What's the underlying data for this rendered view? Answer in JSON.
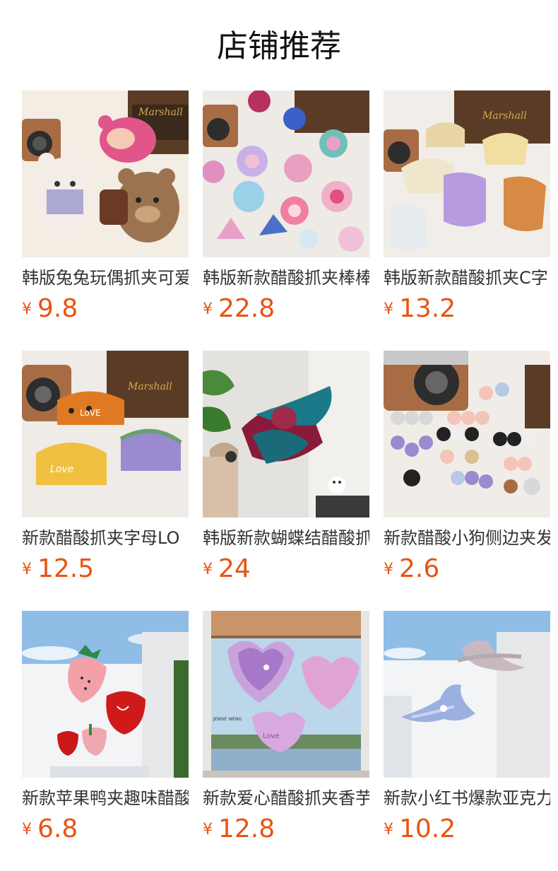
{
  "header": {
    "title": "店铺推荐"
  },
  "products": [
    {
      "name": "韩版兔兔玩偶抓夹可爱",
      "currency": "¥",
      "price": "9.8",
      "image": "plush-bunny-bear-clips-photo"
    },
    {
      "name": "韩版新款醋酸抓夹棒棒",
      "currency": "¥",
      "price": "22.8",
      "image": "lollipop-clips-photo"
    },
    {
      "name": "韩版新款醋酸抓夹C字",
      "currency": "¥",
      "price": "13.2",
      "image": "c-shape-clips-photo"
    },
    {
      "name": "新款醋酸抓夹字母LO",
      "currency": "¥",
      "price": "12.5",
      "image": "love-letter-clips-photo"
    },
    {
      "name": "韩版新款蝴蝶结醋酸抓",
      "currency": "¥",
      "price": "24",
      "image": "bow-clip-photo"
    },
    {
      "name": "新款醋酸小狗侧边夹发",
      "currency": "¥",
      "price": "2.6",
      "image": "puppy-side-clips-photo"
    },
    {
      "name": "新款苹果鸭夹趣味醋酸",
      "currency": "¥",
      "price": "6.8",
      "image": "apple-strawberry-clips-photo"
    },
    {
      "name": "新款爱心醋酸抓夹香芋",
      "currency": "¥",
      "price": "12.8",
      "image": "heart-clips-photo"
    },
    {
      "name": "新款小红书爆款亚克力",
      "currency": "¥",
      "price": "10.2",
      "image": "marble-clips-photo"
    }
  ]
}
